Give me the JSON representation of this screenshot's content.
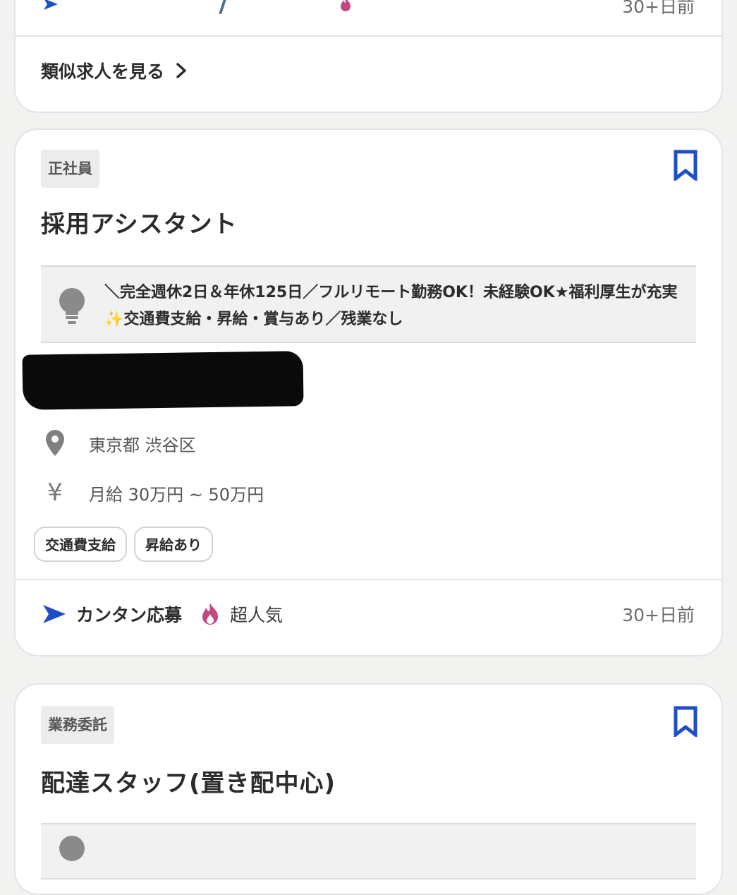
{
  "top_card": {
    "date_label": "30+日前",
    "similar_link": "類似求人を見る"
  },
  "job1": {
    "employment_type": "正社員",
    "title": "採用アシスタント",
    "highlight": "＼完全週休2日＆年休125日／フルリモート勤務OK！未経験OK★福利厚生が充実✨交通費支給・昇給・賞与あり／残業なし",
    "location": "東京都 渋谷区",
    "salary": "月給 30万円 ~ 50万円",
    "tags": [
      "交通費支給",
      "昇給あり"
    ],
    "easy_apply": "カンタン応募",
    "popularity": "超人気",
    "posted": "30+日前"
  },
  "job2": {
    "employment_type": "業務委託",
    "title": "配達スタッフ(置き配中心)"
  },
  "colors": {
    "accent_blue": "#1f4fc6",
    "flame_pink": "#c2477f",
    "background": "#f2f2f1"
  },
  "icons": {
    "bookmark": "bookmark-icon",
    "bulb": "lightbulb-icon",
    "location": "location-pin-icon",
    "salary": "yen-icon",
    "send": "send-arrow-icon",
    "flame": "flame-icon",
    "chevron": "chevron-right-icon"
  }
}
